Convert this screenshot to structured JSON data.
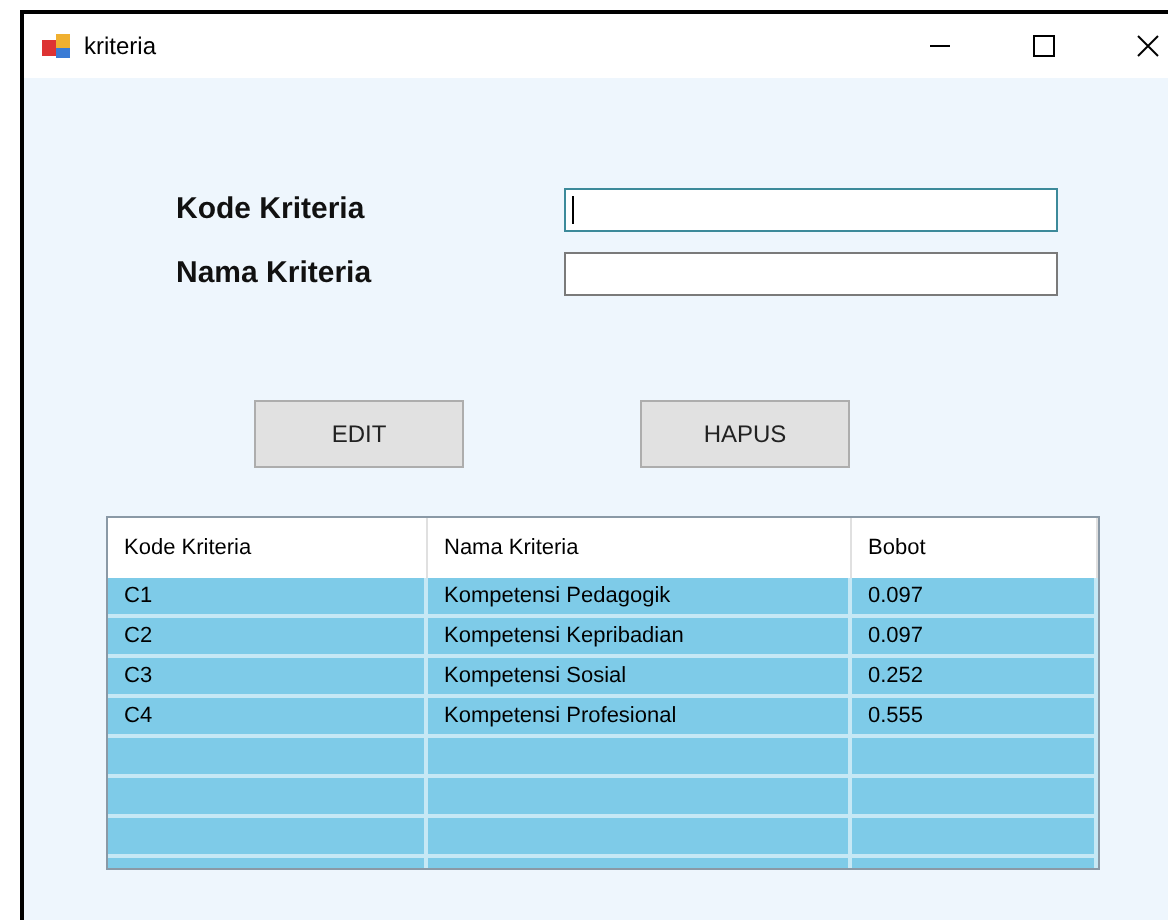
{
  "window": {
    "title": "kriteria"
  },
  "fields": [
    {
      "label": "Kode Kriteria",
      "focused": true
    },
    {
      "label": "Nama Kriteria",
      "focused": false
    }
  ],
  "buttons": [
    "EDIT",
    "HAPUS"
  ],
  "table": {
    "columns": [
      "Kode Kriteria",
      "Nama Kriteria",
      "Bobot"
    ],
    "rows": [
      [
        "C1",
        "Kompetensi Pedagogik",
        "0.097"
      ],
      [
        "C2",
        "Kompetensi Kepribadian",
        "0.097"
      ],
      [
        "C3",
        "Kompetensi Sosial",
        "0.252"
      ],
      [
        "C4",
        "Kompetensi Profesional",
        "0.555"
      ]
    ]
  }
}
